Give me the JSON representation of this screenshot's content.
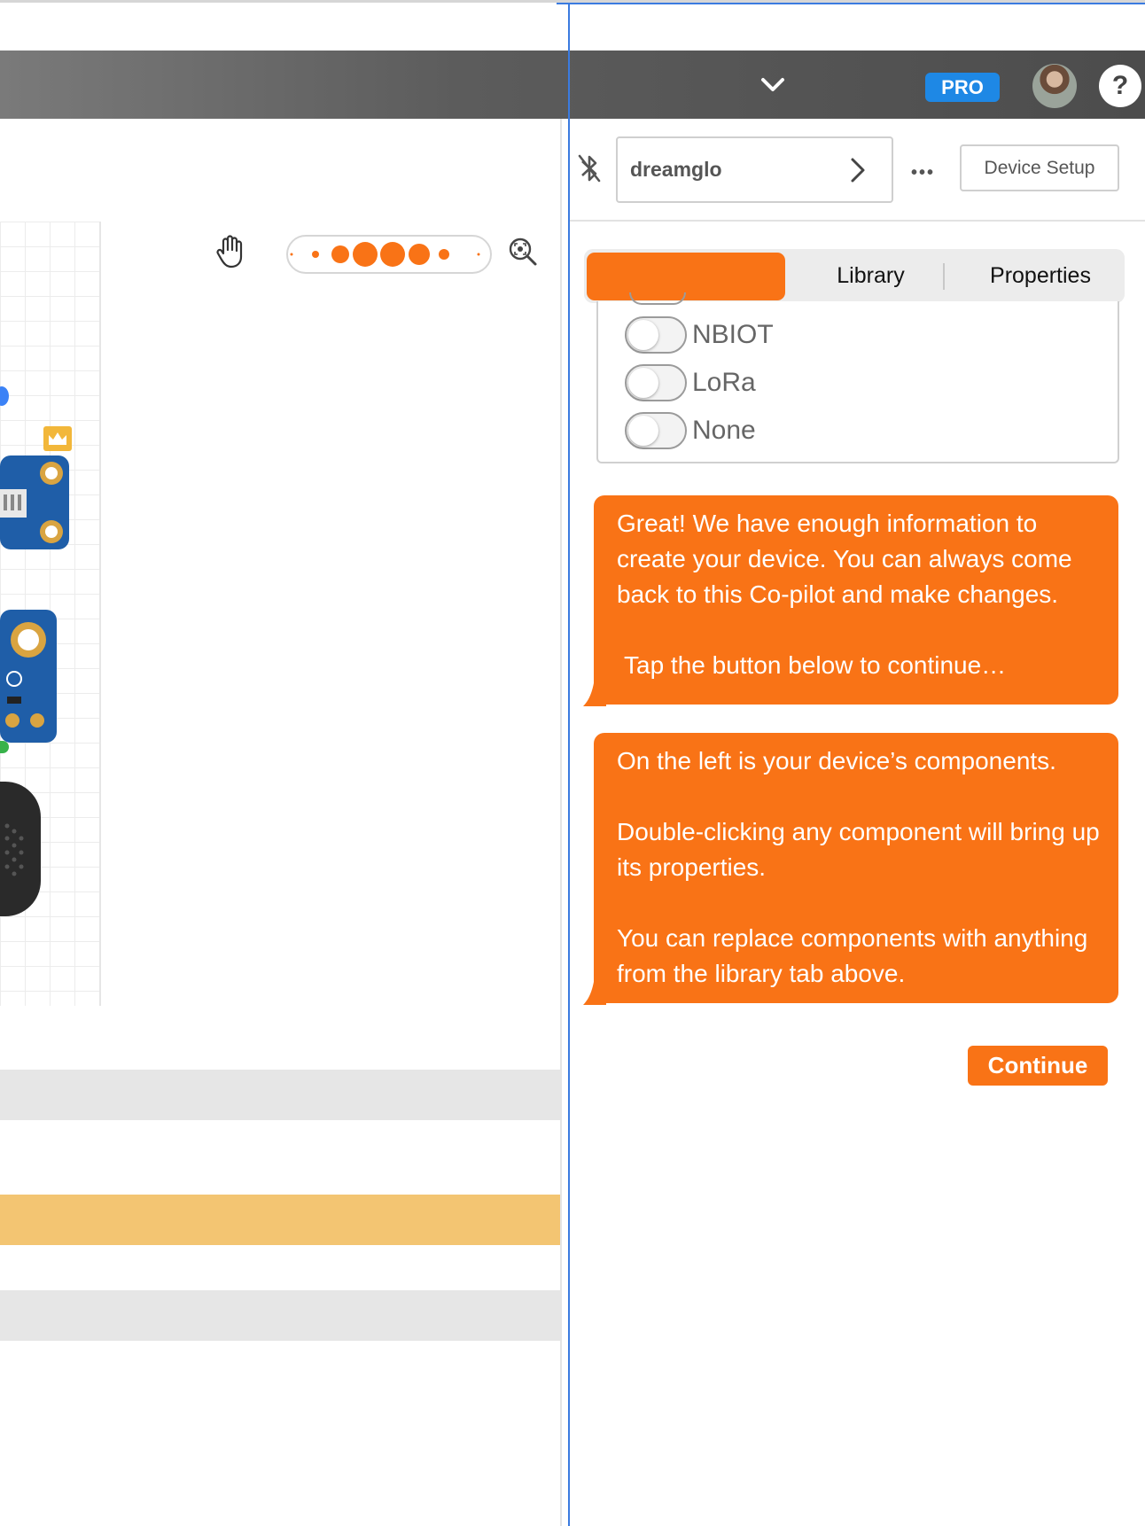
{
  "header": {
    "pro_badge": "PRO",
    "help_label": "?",
    "icons": {
      "dropdown": "chevron-down-icon",
      "avatar": "user-avatar",
      "help": "help-icon"
    }
  },
  "device_toolbar": {
    "device_name": "dreamglo",
    "more_label": "•••",
    "device_setup_label": "Device Setup",
    "icons": {
      "bluetooth": "bluetooth-off-icon",
      "forward": "chevron-right-icon",
      "more": "more-dots-icon"
    }
  },
  "canvas": {
    "icons": {
      "pan": "hand-icon",
      "zoom_fit": "zoom-fit-icon"
    }
  },
  "tabs": {
    "active_label": "",
    "library_label": "Library",
    "properties_label": "Properties"
  },
  "connectivity_options": [
    {
      "label": "NBIOT",
      "on": false
    },
    {
      "label": "LoRa",
      "on": false
    },
    {
      "label": "None",
      "on": false
    }
  ],
  "chat": {
    "message1": [
      "Great! We have enough information to create your device. You can always come back to this Co-pilot and make changes.",
      "Tap the button below to continue…"
    ],
    "message2": [
      "On the left is your device’s components.",
      "Double-clicking any component will bring up its properties.",
      "You can replace components with anything from the library tab above."
    ],
    "continue_label": "Continue"
  },
  "colors": {
    "accent": "#f97316",
    "header_bg": "#5c5c5c",
    "pro_badge": "#1e88e5",
    "divider": "#3b7be0",
    "band_gray": "#e6e6e6",
    "band_yellow": "#f3c572"
  }
}
